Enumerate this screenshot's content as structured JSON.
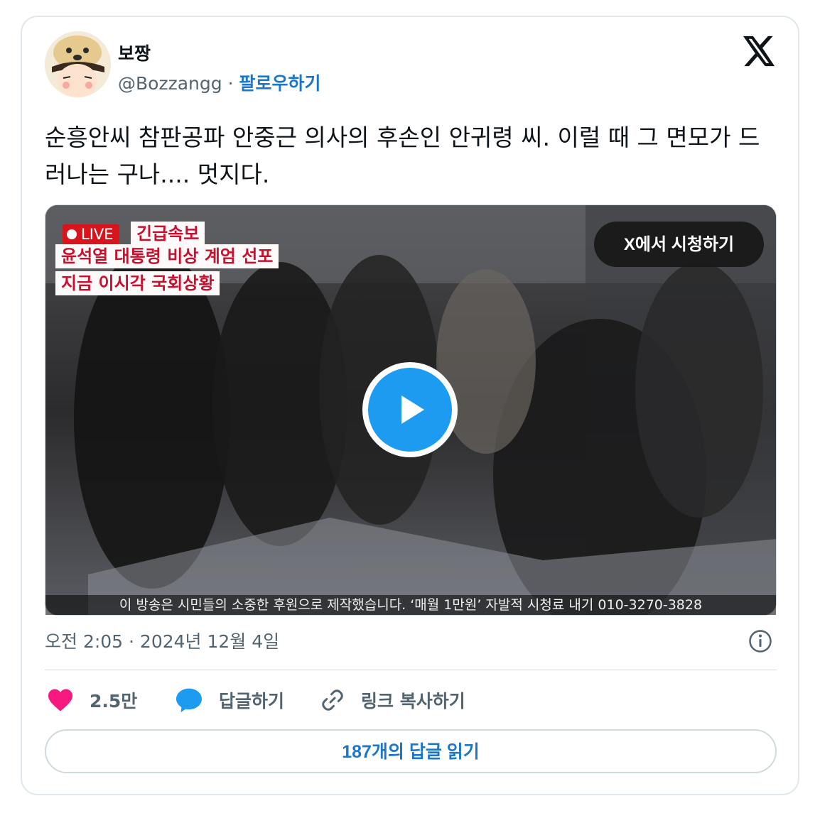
{
  "author": {
    "name": "보짱",
    "handle": "@Bozzangg",
    "separator": "·",
    "follow_label": "팔로우하기"
  },
  "tweet": {
    "text": "순흥안씨 참판공파 안중근 의사의 후손인 안귀령 씨. 이럴 때 그 면모가 드러나는 구나.... 멋지다."
  },
  "media": {
    "live_label": "LIVE",
    "banner_1": "긴급속보",
    "banner_2": "윤석열 대통령 비상 계엄 선포",
    "banner_3": "지금 이시각 국회상황",
    "watch_label": "X에서 시청하기",
    "caption": "이 방송은 시민들의 소중한 후원으로 제작했습니다. ‘매월 1만원’ 자발적 시청료 내기 010-3270-3828"
  },
  "meta": {
    "timestamp": "오전 2:05 · 2024년 12월 4일"
  },
  "actions": {
    "like_count": "2.5만",
    "reply_label": "답글하기",
    "copy_link_label": "링크 복사하기"
  },
  "read_replies_label": "187개의 답글 읽기",
  "colors": {
    "link": "#1d76c9",
    "like": "#f91880",
    "reply": "#1d9bf0",
    "muted": "#536471"
  }
}
